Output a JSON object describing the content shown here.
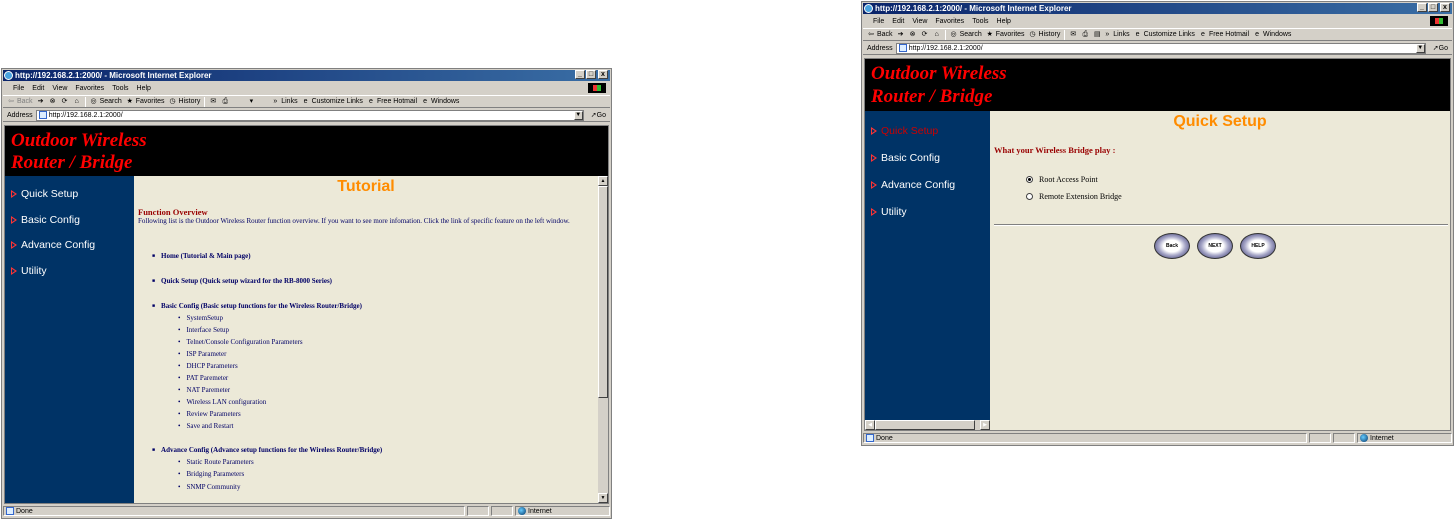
{
  "left_window": {
    "title": "http://192.168.2.1:2000/ - Microsoft Internet Explorer",
    "menu": [
      "File",
      "Edit",
      "View",
      "Favorites",
      "Tools",
      "Help"
    ],
    "toolbar": {
      "back": "Back",
      "search": "Search",
      "favorites": "Favorites",
      "history": "History",
      "chevron": "»",
      "links": "Links",
      "customize_links": "Customize Links",
      "free_hotmail": "Free Hotmail",
      "windows": "Windows"
    },
    "address_label": "Address",
    "address_url": "http://192.168.2.1:2000/",
    "go_label": "Go",
    "banner_line1": "Outdoor Wireless",
    "banner_line2": "Router / Bridge",
    "nav": [
      "Quick Setup",
      "Basic Config",
      "Advance Config",
      "Utility"
    ],
    "page_title": "Tutorial",
    "overview_heading": "Function Overview",
    "overview_text": "Following list is the Outdoor Wireless Router function overview. If you want to see more infomation. Click the link of specific feature on the left window.",
    "items": [
      {
        "label": "Home (Tutorial & Main page)",
        "children": []
      },
      {
        "label": "Quick Setup (Quick setup wizard for the RB-8000 Series)",
        "children": []
      },
      {
        "label": "Basic Config (Basic setup functions for the Wireless Router/Bridge)",
        "children": [
          "SystemSetup",
          "Interface Setup",
          "Telnet/Console Configuration Parameters",
          "ISP Parameter",
          "DHCP Parameters",
          "PAT Paremeter",
          "NAT Paremeter",
          "Wireless LAN configuration",
          "Review Parameters",
          "Save and Restart"
        ]
      },
      {
        "label": "Advance Config (Advance setup functions for the Wireless Router/Bridge)",
        "children": [
          "Static Route Parameters",
          "Bridging Parameters",
          "SNMP Community"
        ]
      }
    ],
    "status_text": "Done",
    "status_zone": "Internet"
  },
  "right_window": {
    "title": "http://192.168.2.1:2000/ - Microsoft Internet Explorer",
    "menu": [
      "File",
      "Edit",
      "View",
      "Favorites",
      "Tools",
      "Help"
    ],
    "toolbar": {
      "back": "Back",
      "search": "Search",
      "favorites": "Favorites",
      "history": "History",
      "chevron": "»",
      "links": "Links",
      "customize_links": "Customize Links",
      "free_hotmail": "Free Hotmail",
      "windows": "Windows"
    },
    "address_label": "Address",
    "address_url": "http://192.168.2.1:2000/",
    "go_label": "Go",
    "banner_line1": "Outdoor Wireless",
    "banner_line2": "Router / Bridge",
    "nav": [
      "Quick Setup",
      "Basic Config",
      "Advance Config",
      "Utility"
    ],
    "active_nav": "Quick Setup",
    "page_title": "Quick Setup",
    "question": "What your Wireless Bridge play :",
    "options": [
      {
        "label": "Root Access Point",
        "selected": true
      },
      {
        "label": "Remote Extension Bridge",
        "selected": false
      }
    ],
    "buttons": [
      "Back",
      "NEXT",
      "HELP"
    ],
    "status_text": "Done",
    "status_zone": "Internet"
  },
  "colors": {
    "banner_text": "#ff0000",
    "banner_bg": "#000000",
    "sidebar_bg": "#003366",
    "page_title": "#ff8c00",
    "heading": "#990000",
    "link_text": "#000066"
  }
}
